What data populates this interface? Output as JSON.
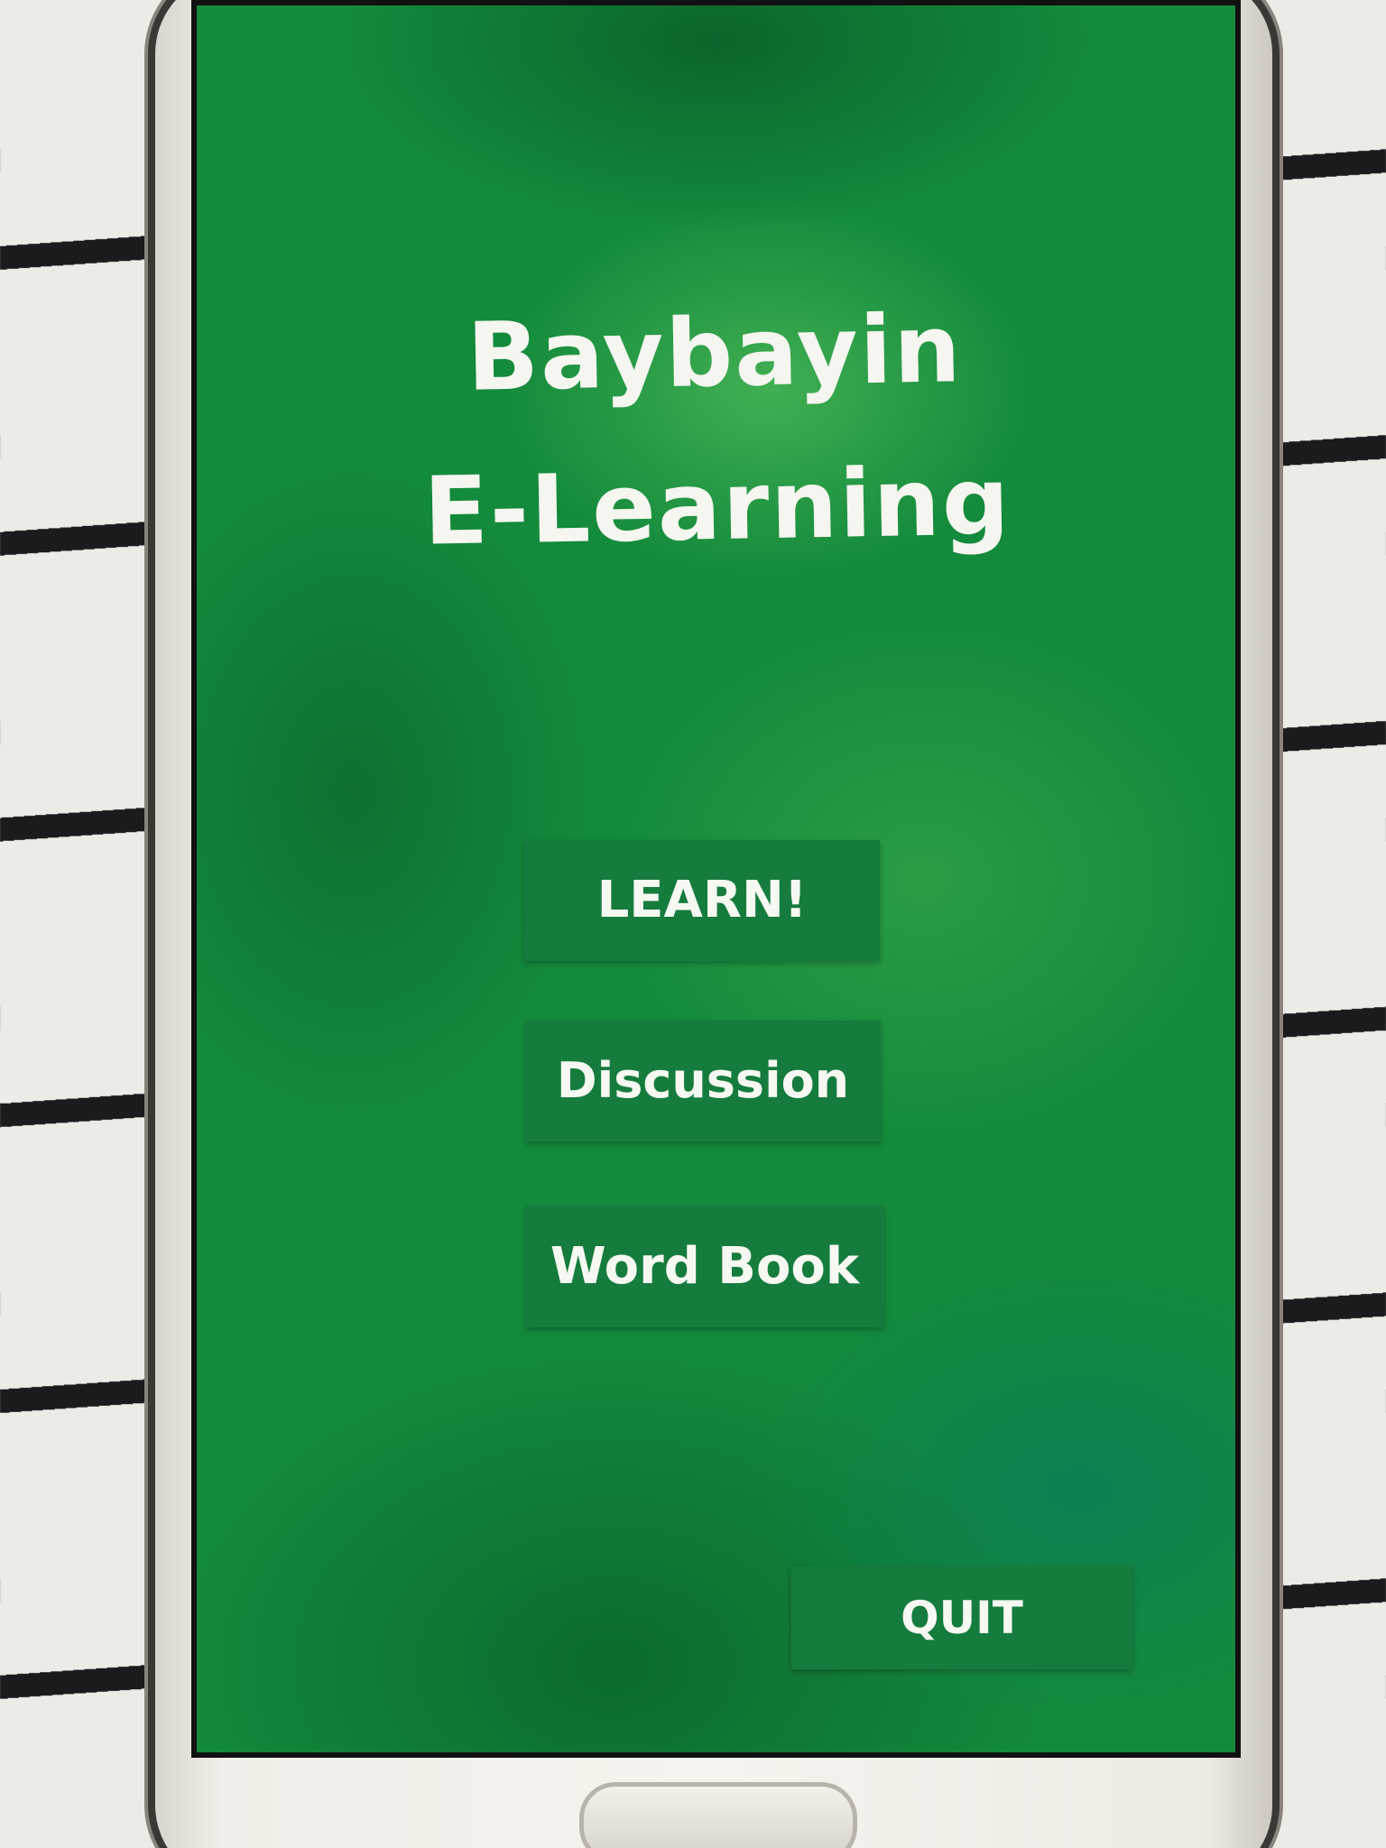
{
  "app": {
    "title_line1": "Baybayin",
    "title_line2": "E-Learning"
  },
  "menu": {
    "learn_label": "LEARN!",
    "discussion_label": "Discussion",
    "wordbook_label": "Word Book",
    "quit_label": "QUIT"
  },
  "colors": {
    "background_green": "#148a3c",
    "button_green": "#157c3d",
    "text_white": "#f4f6ef"
  }
}
